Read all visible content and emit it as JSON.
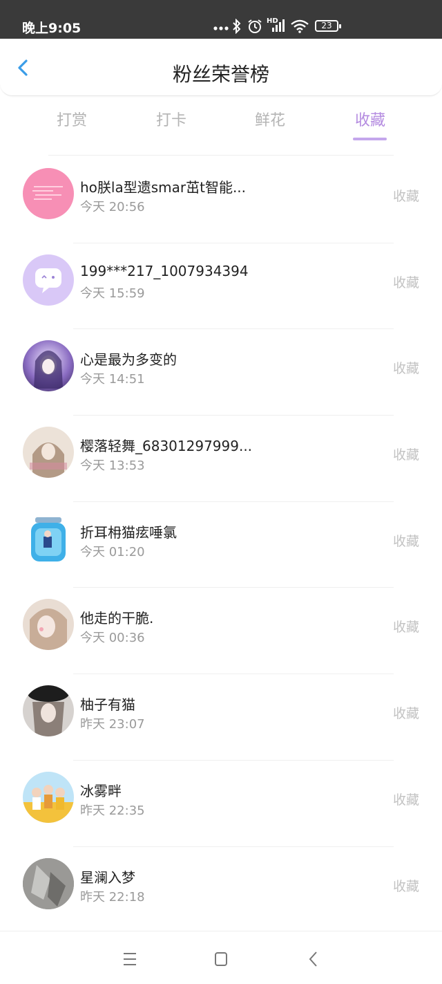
{
  "status_bar": {
    "time": "晚上9:05",
    "battery": "23",
    "icons": [
      "more-dots-icon",
      "bluetooth-icon",
      "alarm-icon",
      "signal-icon",
      "wifi-icon",
      "battery-icon"
    ],
    "hd_label": "HD"
  },
  "header": {
    "title": "粉丝荣誉榜",
    "back_icon": "chevron-left-icon",
    "accent_color": "#3a9de8"
  },
  "tabs": [
    {
      "label": "打赏",
      "active": false
    },
    {
      "label": "打卡",
      "active": false
    },
    {
      "label": "鲜花",
      "active": false
    },
    {
      "label": "收藏",
      "active": true
    }
  ],
  "colors": {
    "active_tab": "#b48be0",
    "inactive_tab": "#b4b4b4",
    "action_text": "#c2c2c2"
  },
  "fans": [
    {
      "name": "ho朕la型遗smar茁t智能...",
      "time": "今天 20:56",
      "action": "收藏",
      "avatar": "pink-text-avatar"
    },
    {
      "name": "199***217_1007934394",
      "time": "今天 15:59",
      "action": "收藏",
      "avatar": "purple-chat-avatar"
    },
    {
      "name": "心是最为多变的",
      "time": "今天 14:51",
      "action": "收藏",
      "avatar": "anime-girl-avatar"
    },
    {
      "name": "樱落轻舞_68301297999...",
      "time": "今天 13:53",
      "action": "收藏",
      "avatar": "beige-girl-avatar"
    },
    {
      "name": "折耳枏猫痃唾氯",
      "time": "今天 01:20",
      "action": "收藏",
      "avatar": "blue-jar-avatar"
    },
    {
      "name": "他走的干脆.",
      "time": "今天 00:36",
      "action": "收藏",
      "avatar": "portrait-avatar"
    },
    {
      "name": "柚子有猫",
      "time": "昨天 23:07",
      "action": "收藏",
      "avatar": "hat-girl-avatar"
    },
    {
      "name": "冰雾畔",
      "time": "昨天 22:35",
      "action": "收藏",
      "avatar": "group-photo-avatar"
    },
    {
      "name": "星澜入梦",
      "time": "昨天 22:18",
      "action": "收藏",
      "avatar": "gray-photo-avatar"
    }
  ],
  "nav_bar": {
    "buttons": [
      "menu-icon",
      "home-square-icon",
      "back-chevron-icon"
    ]
  }
}
